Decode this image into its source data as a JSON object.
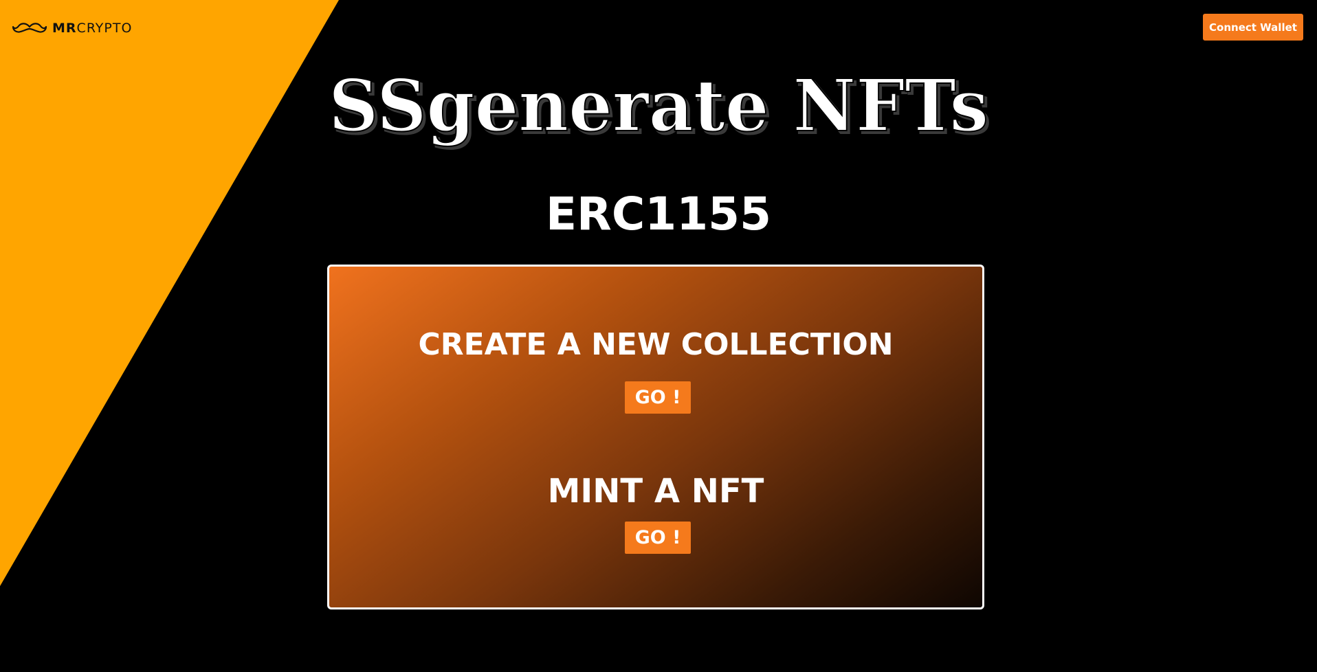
{
  "colors": {
    "background": "#000000",
    "accent_yellow": "#FFA500",
    "button_orange": "#F57A1C",
    "text": "#FFFFFF"
  },
  "header": {
    "logo": {
      "icon": "mustache-icon",
      "brand_bold": "MR",
      "brand_light": "CRYPTO"
    },
    "connect_wallet_label": "Connect Wallet"
  },
  "hero": {
    "title": "SSgenerate NFTs",
    "subtitle": "ERC1155"
  },
  "panel": {
    "create_heading": "CREATE A NEW COLLECTION",
    "create_button": "GO !",
    "mint_heading": "MINT A NFT",
    "mint_button": "GO !"
  }
}
